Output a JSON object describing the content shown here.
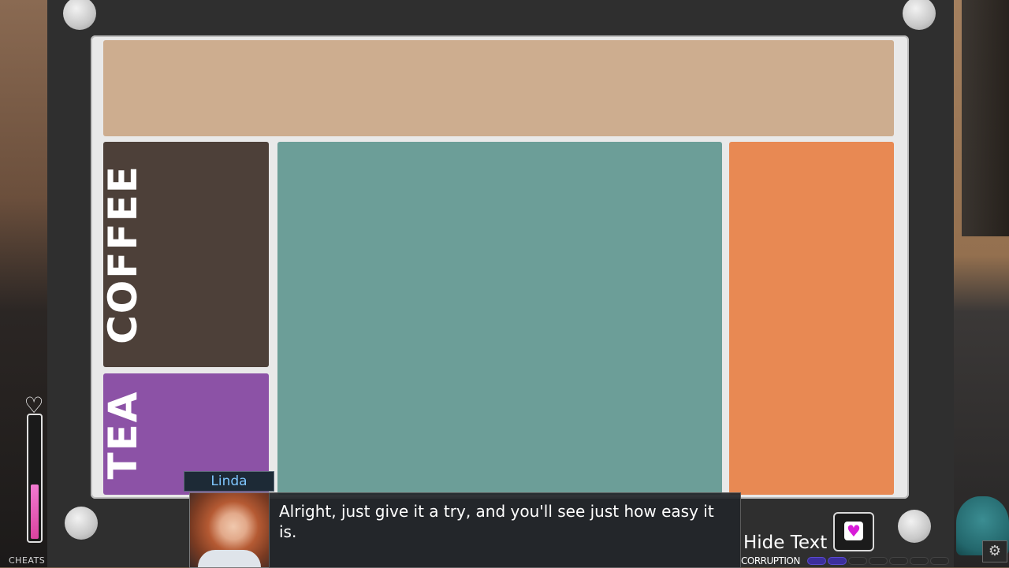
{
  "menu_board": {
    "sections": [
      {
        "label": "COFFEE",
        "color": "#4d4039"
      },
      {
        "label": "TEA",
        "color": "#8c52a6"
      }
    ],
    "top_panel_color": "#cdad8f",
    "middle_panel_color": "#6c9e98",
    "right_panel_color": "#e88953"
  },
  "dialogue": {
    "speaker": "Linda",
    "text": "Alright, just give it a try, and you'll see just how easy it is."
  },
  "hud": {
    "cheats_label": "CHEATS",
    "hide_text_label": "Hide Text",
    "corruption_label": "CORRUPTION",
    "affection_level": 0.45,
    "corruption_filled_segments": 2,
    "corruption_total_segments": 7,
    "heart_icon": "heart-outline-icon",
    "heart_button_icon": "pink-heart-icon",
    "settings_icon": "gear-icon"
  }
}
